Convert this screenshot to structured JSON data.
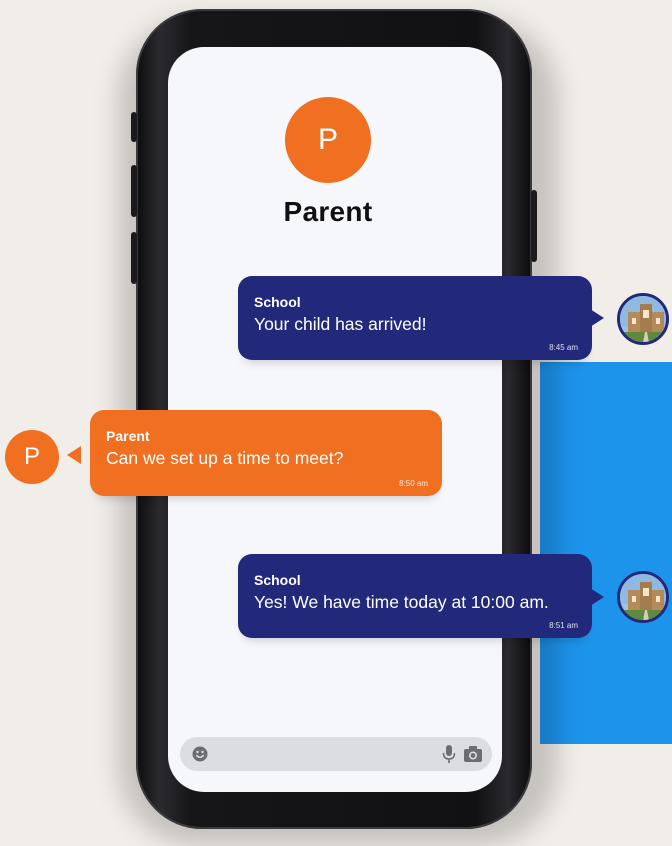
{
  "contact": {
    "avatar_letter": "P",
    "name": "Parent"
  },
  "messages": [
    {
      "sender": "School",
      "text": "Your child has arrived!",
      "time": "8:45 am"
    },
    {
      "sender": "Parent",
      "text": "Can we set up a time to meet?",
      "time": "8:50 am"
    },
    {
      "sender": "School",
      "text": "Yes! We have time today at 10:00 am.",
      "time": "8:51 am"
    }
  ],
  "parent_avatar_letter": "P",
  "icons": {
    "emoji": "smiley-icon",
    "mic": "microphone-icon",
    "camera": "camera-icon",
    "school_avatar": "school-building-photo"
  },
  "colors": {
    "school_bubble": "#23297a",
    "parent_bubble": "#f06f21",
    "accent_panel": "#1d94ec",
    "background": "#f1ede9"
  }
}
